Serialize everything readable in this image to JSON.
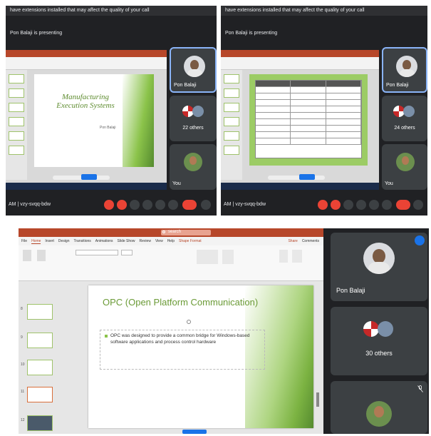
{
  "panel1": {
    "banner": "have extensions installed that may affect the quality of your call",
    "presenting": "Pon Balaji is presenting",
    "slide_title": "Manufacturing Execution Systems",
    "slide_subtitle": "Pon Balaji",
    "meeting_code": "AM | vzy-svqq-bdw",
    "tiles": [
      {
        "label": "Pon Balaji"
      },
      {
        "label": "22 others"
      },
      {
        "label": "You"
      }
    ]
  },
  "panel2": {
    "banner": "have extensions installed that may affect the quality of your call",
    "presenting": "Pon Balaji is presenting",
    "meeting_code": "AM | vzy-svqq-bdw",
    "tiles": [
      {
        "label": "Pon Balaji"
      },
      {
        "label": "24 others"
      },
      {
        "label": "You"
      }
    ]
  },
  "panel3": {
    "search_placeholder": "search",
    "ribbon_tabs": [
      "File",
      "Home",
      "Insert",
      "Design",
      "Transitions",
      "Animations",
      "Slide Show",
      "Review",
      "View",
      "Help",
      "Shape Format"
    ],
    "share_label": "Share",
    "comments_label": "Comments",
    "slide_title": "OPC (Open Platform Communication)",
    "slide_bullet": "OPC was designed to provide a common bridge for Windows-based software applications and process control hardware",
    "thumb_numbers": [
      "8",
      "9",
      "10",
      "11",
      "12"
    ],
    "tiles": [
      {
        "label": "Pon Balaji"
      },
      {
        "label": "30 others"
      },
      {
        "label": ""
      }
    ]
  },
  "colors": {
    "meet_bg": "#202124",
    "tile_bg": "#3c4043",
    "active_border": "#8ab4f8",
    "end_call_red": "#ea4335",
    "ppt_brand": "#b7472a",
    "slide_green": "#8bc34a"
  }
}
